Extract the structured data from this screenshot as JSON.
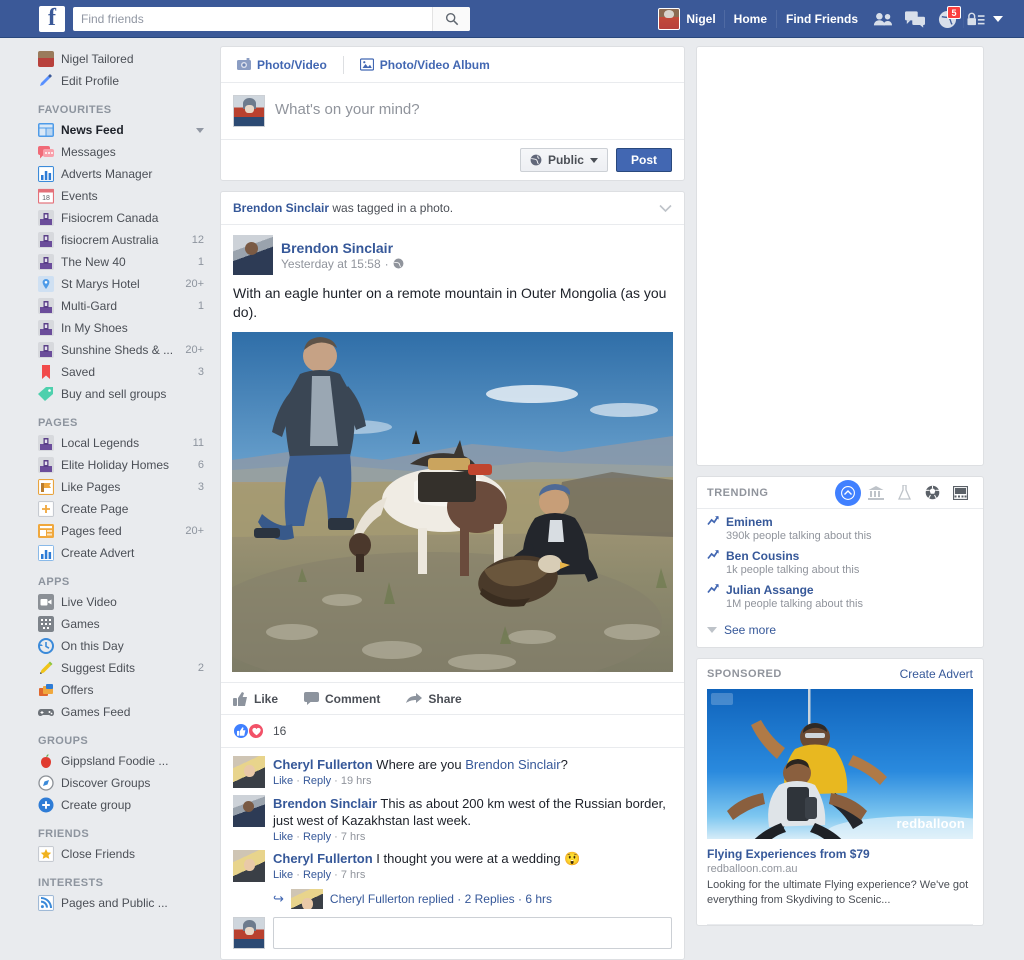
{
  "topnav": {
    "logo": "f",
    "search": {
      "placeholder": "Find friends",
      "value": "",
      "icon": "search-icon"
    },
    "profile_name": "Nigel",
    "home": "Home",
    "find_friends": "Find Friends",
    "icons": [
      "friend-requests-icon",
      "messages-icon",
      "notifications-icon",
      "privacy-shortcuts-icon",
      "account-menu-icon"
    ],
    "notification_badge": "5",
    "brand_color": "#3b5998"
  },
  "sidebar": {
    "profile": {
      "label": "Nigel Tailored",
      "icon": "avatar-icon"
    },
    "edit_profile": {
      "label": "Edit Profile",
      "icon": "pencil-icon"
    },
    "sections": [
      {
        "title": "FAVOURITES",
        "items": [
          {
            "label": "News Feed",
            "count": "",
            "icon": "news-feed-icon",
            "active": true,
            "caret": true
          },
          {
            "label": "Messages",
            "count": "",
            "icon": "messages-icon"
          },
          {
            "label": "Adverts Manager",
            "count": "",
            "icon": "adverts-manager-icon"
          },
          {
            "label": "Events",
            "count": "",
            "icon": "events-icon"
          },
          {
            "label": "Fisiocrem Canada",
            "count": "",
            "icon": "page-icon"
          },
          {
            "label": "fisiocrem Australia",
            "count": "12",
            "icon": "page-icon"
          },
          {
            "label": "The New 40",
            "count": "1",
            "icon": "page-icon"
          },
          {
            "label": "St Marys Hotel",
            "count": "20+",
            "icon": "location-icon"
          },
          {
            "label": "Multi-Gard",
            "count": "1",
            "icon": "page-icon"
          },
          {
            "label": "In My Shoes",
            "count": "",
            "icon": "page-icon"
          },
          {
            "label": "Sunshine Sheds & ...",
            "count": "20+",
            "icon": "page-icon"
          },
          {
            "label": "Saved",
            "count": "3",
            "icon": "bookmark-icon"
          },
          {
            "label": "Buy and sell groups",
            "count": "",
            "icon": "tag-icon"
          }
        ]
      },
      {
        "title": "PAGES",
        "items": [
          {
            "label": "Local Legends",
            "count": "11",
            "icon": "page-icon"
          },
          {
            "label": "Elite Holiday Homes",
            "count": "6",
            "icon": "page-icon"
          },
          {
            "label": "Like Pages",
            "count": "3",
            "icon": "like-pages-icon"
          },
          {
            "label": "Create Page",
            "count": "",
            "icon": "plus-icon"
          },
          {
            "label": "Pages feed",
            "count": "20+",
            "icon": "pages-feed-icon"
          },
          {
            "label": "Create Advert",
            "count": "",
            "icon": "create-advert-icon"
          }
        ]
      },
      {
        "title": "APPS",
        "items": [
          {
            "label": "Live Video",
            "count": "",
            "icon": "live-video-icon"
          },
          {
            "label": "Games",
            "count": "",
            "icon": "games-icon"
          },
          {
            "label": "On this Day",
            "count": "",
            "icon": "on-this-day-icon"
          },
          {
            "label": "Suggest Edits",
            "count": "2",
            "icon": "suggest-edits-icon"
          },
          {
            "label": "Offers",
            "count": "",
            "icon": "offers-icon"
          },
          {
            "label": "Games Feed",
            "count": "",
            "icon": "games-feed-icon"
          }
        ]
      },
      {
        "title": "GROUPS",
        "items": [
          {
            "label": "Gippsland Foodie ...",
            "count": "",
            "icon": "apple-icon"
          },
          {
            "label": "Discover Groups",
            "count": "",
            "icon": "compass-icon"
          },
          {
            "label": "Create group",
            "count": "",
            "icon": "plus-circle-icon"
          }
        ]
      },
      {
        "title": "FRIENDS",
        "items": [
          {
            "label": "Close Friends",
            "count": "",
            "icon": "star-icon"
          }
        ]
      },
      {
        "title": "INTERESTS",
        "items": [
          {
            "label": "Pages and Public ...",
            "count": "",
            "icon": "rss-icon"
          }
        ]
      }
    ]
  },
  "composer": {
    "tab_photo_video": "Photo/Video",
    "tab_photo_video_album": "Photo/Video Album",
    "placeholder": "What's on your mind?",
    "value": "",
    "privacy": "Public",
    "post_button": "Post"
  },
  "post": {
    "story_actor": "Brendon Sinclair",
    "story_text": "was tagged in a photo.",
    "author": "Brendon Sinclair",
    "timestamp": "Yesterday at 15:58",
    "privacy_icon": "globe-icon",
    "message": "With an eagle hunter on a remote mountain in Outer Mongolia (as you do).",
    "photo_alt": "Two men and a horse on a rocky mountainside with a golden eagle",
    "actions": {
      "like": "Like",
      "comment": "Comment",
      "share": "Share"
    },
    "reaction_count": "16",
    "comments": [
      {
        "author": "Cheryl Fullerton",
        "text": "Where are you ",
        "mention": "Brendon Sinclair",
        "text_after": "?",
        "like": "Like",
        "reply": "Reply",
        "time": "19 hrs",
        "avatar": "cheryl-avatar"
      },
      {
        "author": "Brendon Sinclair",
        "text": "This as about 200 km west of the Russian border, just west of Kazakhstan last week.",
        "like": "Like",
        "reply": "Reply",
        "time": "7 hrs",
        "avatar": "brendon-avatar"
      },
      {
        "author": "Cheryl Fullerton",
        "text": "I thought you were at a wedding ",
        "emoji": "😲",
        "like": "Like",
        "reply": "Reply",
        "time": "7 hrs",
        "avatar": "cheryl-avatar"
      }
    ],
    "replied_row": {
      "text": "Cheryl Fullerton replied",
      "count": "2 Replies",
      "time": "6 hrs"
    }
  },
  "trending": {
    "title": "TRENDING",
    "tabs": [
      "trending-all-icon",
      "politics-icon",
      "science-icon",
      "sports-icon",
      "entertainment-icon"
    ],
    "selected_tab": 0,
    "items": [
      {
        "name": "Eminem",
        "sub": "390k people talking about this"
      },
      {
        "name": "Ben Cousins",
        "sub": "1k people talking about this"
      },
      {
        "name": "Julian Assange",
        "sub": "1M people talking about this"
      }
    ],
    "see_more": "See more"
  },
  "sponsored": {
    "title": "SPONSORED",
    "create_advert": "Create Advert",
    "ad": {
      "watermark": "redballoon",
      "headline": "Flying Experiences from $79",
      "url": "redballoon.com.au",
      "description": "Looking for the ultimate Flying experience? We've got everything from Skydiving to Scenic..."
    }
  }
}
